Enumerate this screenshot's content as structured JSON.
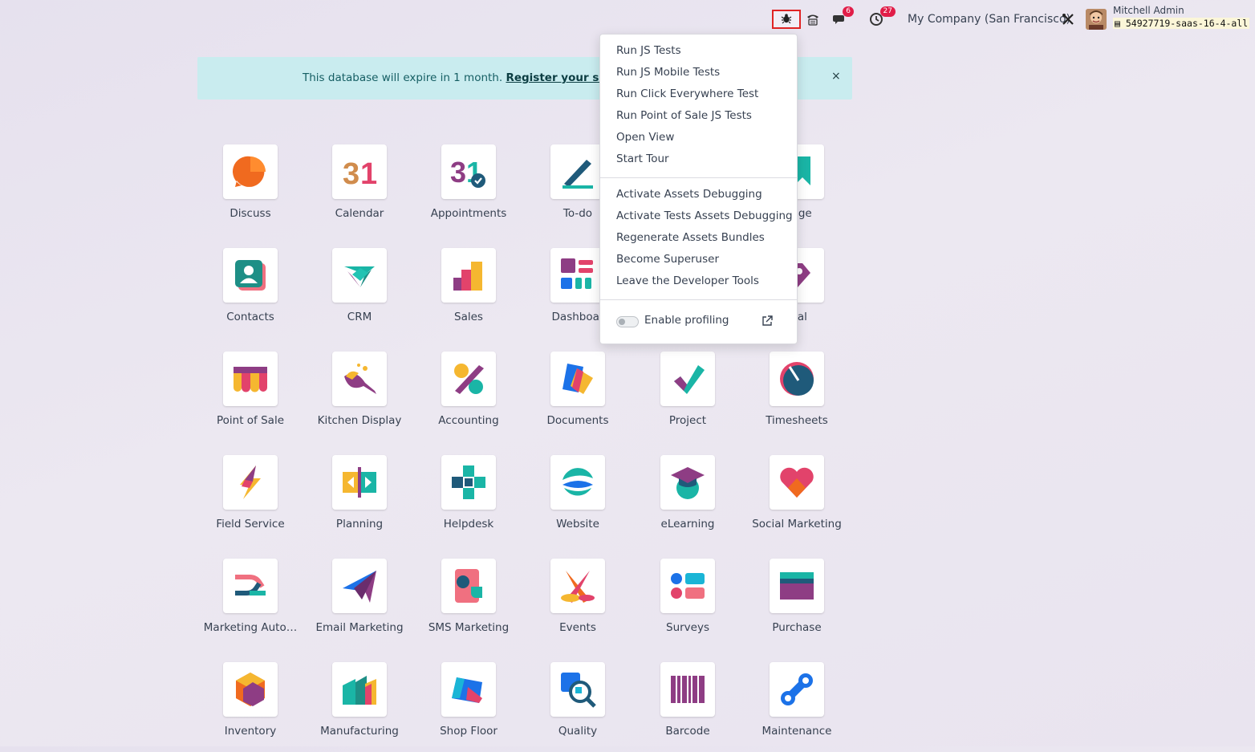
{
  "topbar": {
    "chat_badge": "6",
    "activity_badge": "27",
    "company": "My Company (San Francisco)",
    "user_name": "Mitchell Admin",
    "database": "54927719-saas-16-4-all"
  },
  "banner": {
    "text": "This database will expire in 1 month. ",
    "link": "Register your subscri",
    "close": "×"
  },
  "apps": [
    {
      "label": "Discuss",
      "icon": "discuss-icon"
    },
    {
      "label": "Calendar",
      "icon": "calendar-icon"
    },
    {
      "label": "Appointments",
      "icon": "appointments-icon"
    },
    {
      "label": "To-do",
      "icon": "todo-icon"
    },
    {
      "label": "ledge",
      "icon": "knowledge-icon"
    },
    {
      "label": "Contacts",
      "icon": "contacts-icon"
    },
    {
      "label": "CRM",
      "icon": "crm-icon"
    },
    {
      "label": "Sales",
      "icon": "sales-icon"
    },
    {
      "label": "Dashboar",
      "icon": "dashboards-icon"
    },
    {
      "label": "ntal",
      "icon": "rental-icon"
    },
    {
      "label": "Point of Sale",
      "icon": "point-of-sale-icon"
    },
    {
      "label": "Kitchen Display",
      "icon": "kitchen-display-icon"
    },
    {
      "label": "Accounting",
      "icon": "accounting-icon"
    },
    {
      "label": "Documents",
      "icon": "documents-icon"
    },
    {
      "label": "Project",
      "icon": "project-icon"
    },
    {
      "label": "Timesheets",
      "icon": "timesheets-icon"
    },
    {
      "label": "Field Service",
      "icon": "field-service-icon"
    },
    {
      "label": "Planning",
      "icon": "planning-icon"
    },
    {
      "label": "Helpdesk",
      "icon": "helpdesk-icon"
    },
    {
      "label": "Website",
      "icon": "website-icon"
    },
    {
      "label": "eLearning",
      "icon": "elearning-icon"
    },
    {
      "label": "Social Marketing",
      "icon": "social-marketing-icon"
    },
    {
      "label": "Marketing Auto…",
      "icon": "marketing-automation-icon"
    },
    {
      "label": "Email Marketing",
      "icon": "email-marketing-icon"
    },
    {
      "label": "SMS Marketing",
      "icon": "sms-marketing-icon"
    },
    {
      "label": "Events",
      "icon": "events-icon"
    },
    {
      "label": "Surveys",
      "icon": "surveys-icon"
    },
    {
      "label": "Purchase",
      "icon": "purchase-icon"
    },
    {
      "label": "Inventory",
      "icon": "inventory-icon"
    },
    {
      "label": "Manufacturing",
      "icon": "manufacturing-icon"
    },
    {
      "label": "Shop Floor",
      "icon": "shop-floor-icon"
    },
    {
      "label": "Quality",
      "icon": "quality-icon"
    },
    {
      "label": "Barcode",
      "icon": "barcode-icon"
    },
    {
      "label": "Maintenance",
      "icon": "maintenance-icon"
    }
  ],
  "debug_menu": {
    "items": [
      "Run JS Tests",
      "Run JS Mobile Tests",
      "Run Click Everywhere Test",
      "Run Point of Sale JS Tests",
      "Open View",
      "Start Tour",
      "Activate Assets Debugging",
      "Activate Tests Assets Debugging",
      "Regenerate Assets Bundles",
      "Become Superuser",
      "Leave the Developer Tools"
    ],
    "profiling_label": "Enable profiling",
    "profiling_enabled": false
  },
  "colors": {
    "accent_red": "#e02424",
    "badge": "#e11d48",
    "banner_bg": "#c9ecef"
  }
}
